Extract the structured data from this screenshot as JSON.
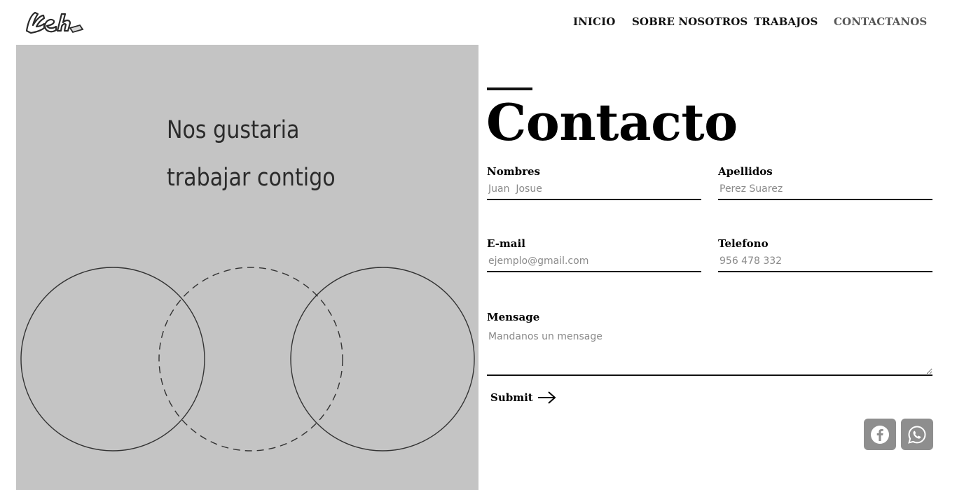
{
  "brand": {
    "logo_text": "Keh"
  },
  "nav": {
    "items": [
      {
        "label": "INICIO",
        "active": false
      },
      {
        "label": "SOBRE NOSOTROS",
        "active": false
      },
      {
        "label": "TRABAJOS",
        "active": false
      },
      {
        "label": "CONTACTANOS",
        "active": true
      }
    ]
  },
  "hero": {
    "tagline_line1": "Nos gustaria",
    "tagline_line2": "trabajar contigo",
    "panel_color": "#c4c4c4"
  },
  "contact": {
    "title": "Contacto",
    "fields": {
      "nombres": {
        "label": "Nombres",
        "placeholder": "Juan  Josue"
      },
      "apellidos": {
        "label": "Apellidos",
        "placeholder": "Perez Suarez"
      },
      "email": {
        "label": "E-mail",
        "placeholder": "ejemplo@gmail.com"
      },
      "telefono": {
        "label": "Telefono",
        "placeholder": "956 478 332"
      },
      "mensaje": {
        "label": "Mensage",
        "placeholder": "Mandanos un mensage"
      }
    },
    "submit_label": "Submit",
    "submit_icon": "arrow-right-icon"
  },
  "social": [
    {
      "name": "facebook-icon"
    },
    {
      "name": "whatsapp-icon"
    }
  ]
}
